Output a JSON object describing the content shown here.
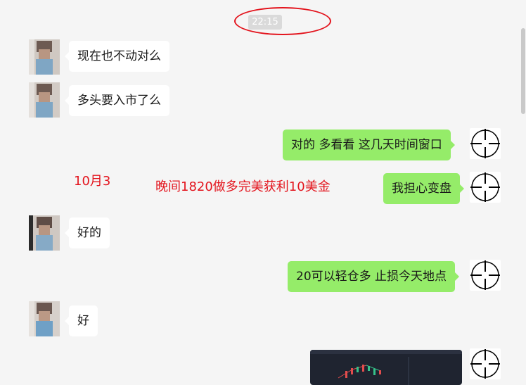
{
  "timestamp": "22:15",
  "messages": [
    {
      "side": "in",
      "text": "现在也不动对么"
    },
    {
      "side": "in",
      "text": "多头要入市了么"
    },
    {
      "side": "out",
      "text": "对的  多看看  这几天时间窗口"
    },
    {
      "side": "out",
      "text": "我担心变盘"
    },
    {
      "side": "in",
      "text": "好的"
    },
    {
      "side": "out",
      "text": "20可以轻仓多  止损今天地点"
    },
    {
      "side": "in",
      "text": "好"
    }
  ],
  "annotations": {
    "date": "10月3",
    "result": "晚间1820做多完美获利10美金"
  },
  "colors": {
    "background": "#f5f5f5",
    "bubble_in": "#ffffff",
    "bubble_out": "#95ec69",
    "annotation_red": "#e3141d"
  },
  "icons": {
    "self_avatar": "crosshair-icon",
    "other_avatar": "pixelated-avatar"
  }
}
